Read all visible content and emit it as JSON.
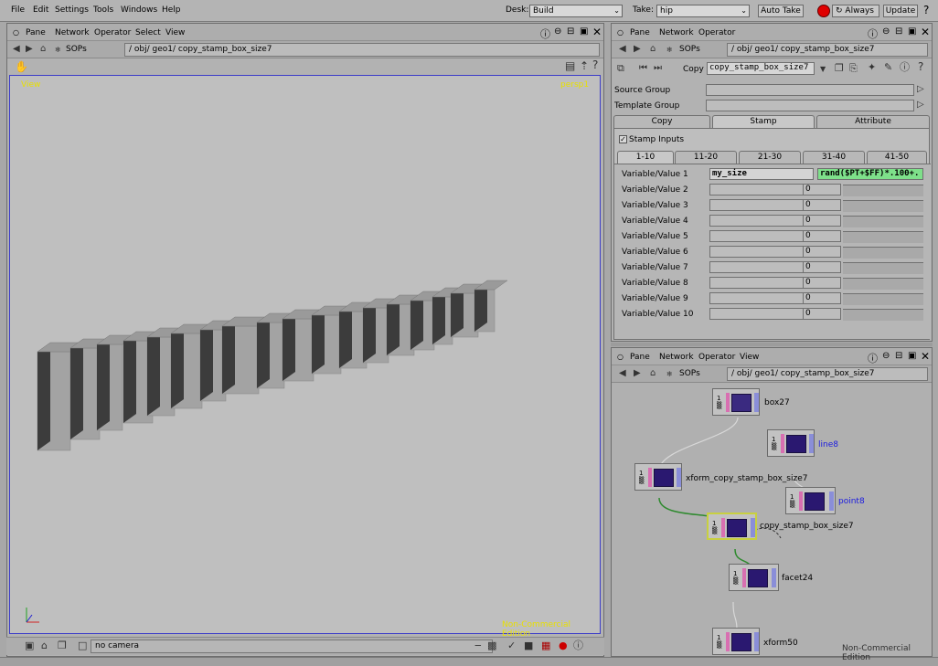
{
  "menubar": {
    "items": [
      "File",
      "Edit",
      "Settings",
      "Tools",
      "Windows",
      "Help"
    ],
    "desk_label": "Desk:",
    "desk_value": "Build",
    "take_label": "Take:",
    "take_value": "hip",
    "auto_take": "Auto Take",
    "always": "Always",
    "update": "Update",
    "help": "?"
  },
  "viewer_pane": {
    "menu": [
      "Pane",
      "Network",
      "Operator",
      "Select",
      "View"
    ],
    "context": "SOPs",
    "path": "/ obj/ geo1/ copy_stamp_box_size7",
    "view_label": "View",
    "camera_label": "persp1",
    "watermark": "Non-Commercial Edition",
    "camera_field": "no camera"
  },
  "param_pane": {
    "menu": [
      "Pane",
      "Network",
      "Operator"
    ],
    "context": "SOPs",
    "path": "/ obj/ geo1/ copy_stamp_box_size7",
    "op_type": "Copy",
    "op_name": "copy_stamp_box_size7",
    "source_group_label": "Source Group",
    "template_group_label": "Template Group",
    "tabs": [
      "Copy",
      "Stamp",
      "Attribute"
    ],
    "stamp_inputs_label": "Stamp Inputs",
    "subtabs": [
      "1-10",
      "11-20",
      "21-30",
      "31-40",
      "41-50"
    ],
    "rows": [
      {
        "label": "Variable/Value 1",
        "var": "my_size",
        "val": "rand($PT+$FF)*.100+."
      },
      {
        "label": "Variable/Value 2",
        "var": "",
        "val": "0"
      },
      {
        "label": "Variable/Value 3",
        "var": "",
        "val": "0"
      },
      {
        "label": "Variable/Value 4",
        "var": "",
        "val": "0"
      },
      {
        "label": "Variable/Value 5",
        "var": "",
        "val": "0"
      },
      {
        "label": "Variable/Value 6",
        "var": "",
        "val": "0"
      },
      {
        "label": "Variable/Value 7",
        "var": "",
        "val": "0"
      },
      {
        "label": "Variable/Value 8",
        "var": "",
        "val": "0"
      },
      {
        "label": "Variable/Value 9",
        "var": "",
        "val": "0"
      },
      {
        "label": "Variable/Value 10",
        "var": "",
        "val": "0"
      }
    ]
  },
  "network_pane": {
    "menu": [
      "Pane",
      "Network",
      "Operator",
      "View"
    ],
    "context": "SOPs",
    "path": "/ obj/ geo1/ copy_stamp_box_size7",
    "watermark": "Non-Commercial Edition",
    "nodes": [
      "box27",
      "line8",
      "xform_copy_stamp_box_size7",
      "point8",
      "copy_stamp_box_size7",
      "facet24",
      "xform50"
    ]
  },
  "colors": {
    "accent_yellow": "#e8e000",
    "node_link": "#1a1ae0",
    "wire_green": "#2e8a2e",
    "display_flag": "#c8d040"
  }
}
